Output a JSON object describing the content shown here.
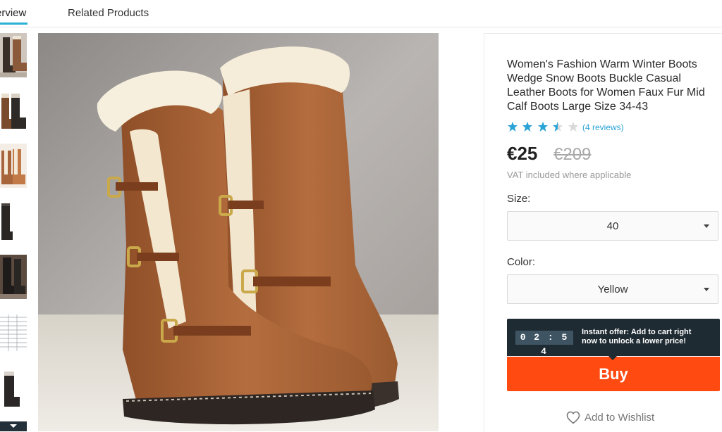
{
  "tabs": [
    {
      "label": "Overview",
      "visible_label": "erview",
      "active": true
    },
    {
      "label": "Related Products",
      "active": false
    }
  ],
  "thumbnails": [
    {
      "icon": "boots-thumbnail"
    },
    {
      "icon": "boots-thumbnail"
    },
    {
      "icon": "boots-thumbnail"
    },
    {
      "icon": "boots-thumbnail"
    },
    {
      "icon": "boots-thumbnail"
    },
    {
      "icon": "size-chart-thumbnail"
    },
    {
      "icon": "boots-thumbnail"
    }
  ],
  "main_image": {
    "icon": "brown-fur-lined-winter-boots-image"
  },
  "product": {
    "title": "Women's Fashion Warm Winter Boots Wedge Snow Boots Buckle Casual Leather Boots for Women Faux Fur Mid Calf Boots Large Size 34-43",
    "rating": 3.5,
    "rating_max": 5,
    "reviews_link": "(4 reviews)",
    "price": "€25",
    "old_price": "€209",
    "vat_note": "VAT included where applicable",
    "size_label": "Size:",
    "size_value": "40",
    "color_label": "Color:",
    "color_value": "Yellow",
    "timer": "02:54",
    "offer_text": "Instant offer: Add to cart right now to unlock a lower price!",
    "buy_label": "Buy",
    "wishlist_label": "Add to Wishlist"
  },
  "colors": {
    "accent": "#2bb0d8",
    "buy": "#ff4a12",
    "offer_bg": "#1f2b33",
    "timer_bg": "#3e5462",
    "star": "#2aa3d6",
    "star_empty": "#d9d9d9"
  }
}
